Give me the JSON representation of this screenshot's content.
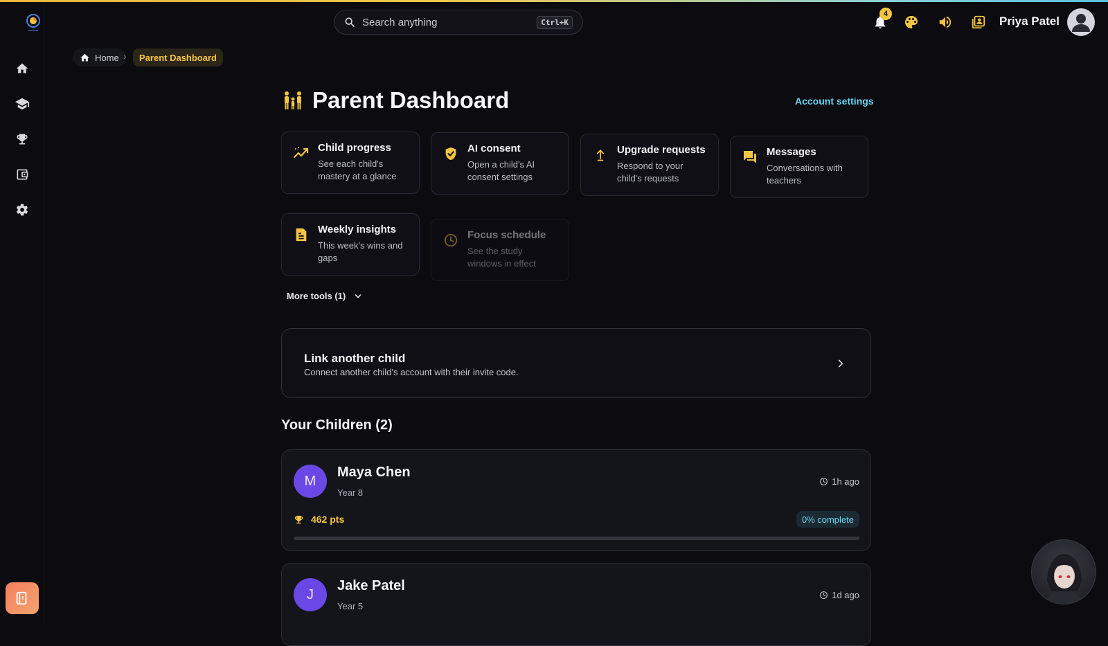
{
  "colors": {
    "accent": "#f5c542",
    "link": "#6ad4f0",
    "avatar": "#6a48e6",
    "background": "#0b0b10"
  },
  "sidebar": {
    "items": [
      {
        "icon": "home-icon"
      },
      {
        "icon": "graduation-cap-icon"
      },
      {
        "icon": "trophy-icon"
      },
      {
        "icon": "wallet-icon"
      },
      {
        "icon": "gear-icon"
      }
    ],
    "help_icon": "help-book-icon"
  },
  "header": {
    "search_placeholder": "Search anything",
    "search_shortcut": "Ctrl+K",
    "notifications_count": "4",
    "user_name": "Priya Patel"
  },
  "breadcrumb": {
    "home": "Home",
    "separator": "›",
    "current": "Parent Dashboard"
  },
  "page": {
    "title": "Parent Dashboard",
    "account_settings": "Account settings"
  },
  "tools": [
    {
      "name": "Child progress",
      "desc": "See each child's mastery at a glance",
      "icon": "trend-up-icon"
    },
    {
      "name": "AI consent",
      "desc": "Open a child's AI consent settings",
      "icon": "shield-check-icon"
    },
    {
      "name": "Upgrade requests",
      "desc": "Respond to your child's requests",
      "icon": "upload-arrow-icon"
    },
    {
      "name": "Messages",
      "desc": "Conversations with teachers",
      "icon": "chat-icon"
    },
    {
      "name": "Weekly insights",
      "desc": "This week's wins and gaps",
      "icon": "document-icon"
    },
    {
      "name": "Focus schedule",
      "desc": "See the study windows in effect",
      "icon": "clock-icon"
    }
  ],
  "more_tools": "More tools (1)",
  "link_child": {
    "title": "Link another child",
    "desc": "Connect another child's account with their invite code."
  },
  "children_title": "Your Children (2)",
  "children": [
    {
      "initial": "M",
      "name": "Maya Chen",
      "year": "Year 8",
      "last_active": "1h ago",
      "points": "462 pts",
      "complete": "0% complete",
      "progress": 0
    },
    {
      "initial": "J",
      "name": "Jake Patel",
      "year": "Year 5",
      "last_active": "1d ago"
    }
  ]
}
